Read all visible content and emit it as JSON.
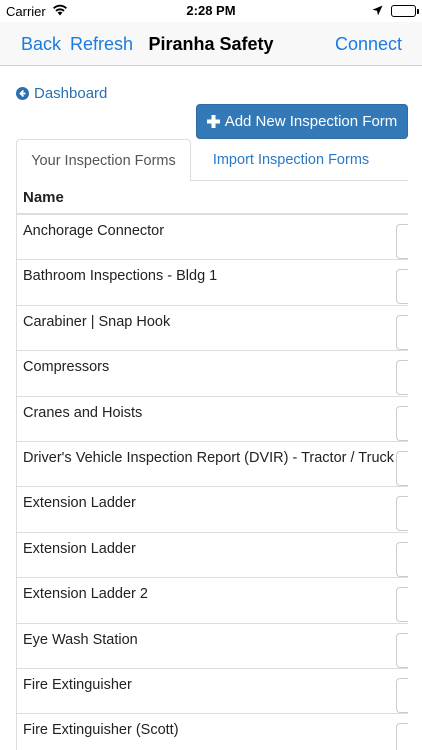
{
  "status_bar": {
    "carrier": "Carrier",
    "time": "2:28 PM"
  },
  "nav": {
    "back_label": "Back",
    "refresh_label": "Refresh",
    "title": "Piranha Safety",
    "connect_label": "Connect",
    "accent_color": "#1a7be0"
  },
  "dashboard_link": {
    "label": "Dashboard",
    "icon": "arrow-circle-left-icon"
  },
  "add_button": {
    "label": "Add New Inspection Form",
    "icon": "plus-icon",
    "color": "#3379b7"
  },
  "tabs": [
    {
      "label": "Your Inspection Forms",
      "active": true
    },
    {
      "label": "Import Inspection Forms",
      "active": false
    }
  ],
  "table": {
    "header": "Name",
    "rows": [
      "Anchorage Connector",
      "Bathroom Inspections - Bldg 1",
      "Carabiner | Snap Hook",
      "Compressors",
      "Cranes and Hoists",
      "Driver's Vehicle Inspection Report (DVIR) - Tractor / Truck",
      "Extension Ladder",
      "Extension Ladder",
      "Extension Ladder 2",
      "Eye Wash Station",
      "Fire Extinguisher",
      "Fire Extinguisher (Scott)"
    ]
  }
}
